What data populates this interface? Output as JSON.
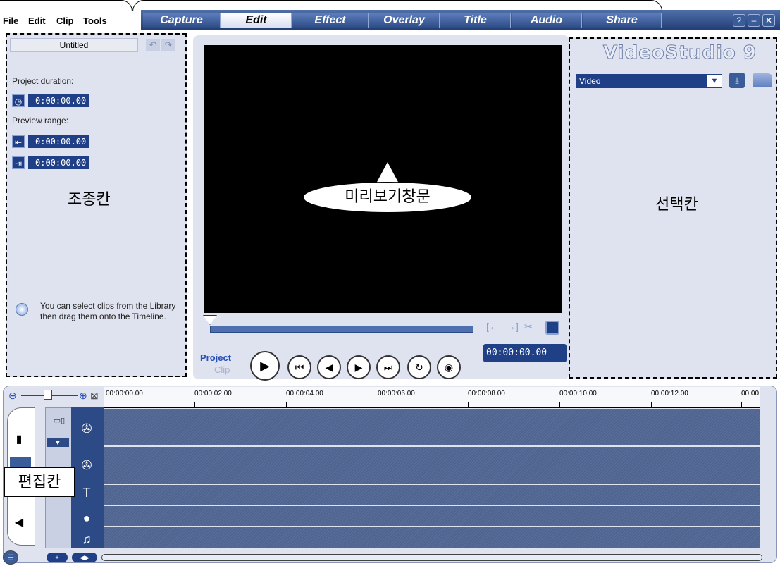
{
  "menu": [
    "File",
    "Edit",
    "Clip",
    "Tools"
  ],
  "tabs": [
    "Capture",
    "Edit",
    "Effect",
    "Overlay",
    "Title",
    "Audio",
    "Share"
  ],
  "active_tab": "Edit",
  "window_buttons": [
    "?",
    "–",
    "✕"
  ],
  "left_panel": {
    "project_name": "Untitled",
    "project_duration_label": "Project duration:",
    "project_duration": "0:00:00.00",
    "preview_range_label": "Preview range:",
    "range_start": "0:00:00.00",
    "range_end": "0:00:00.00",
    "region_label": "조종칸",
    "hint": "You can select clips from the Library then drag them onto the Timeline."
  },
  "preview": {
    "bubble_text": "미리보기창문",
    "mode_project": "Project",
    "mode_clip": "Clip",
    "timecode": "00:00:00.00"
  },
  "library": {
    "brand": "VideoStudio 9",
    "selected": "Video",
    "region_label": "선택칸"
  },
  "timeline": {
    "ticks": [
      "00:00:00.00",
      "00:00:02.00",
      "00:00:04.00",
      "00:00:06.00",
      "00:00:08.00",
      "00:00:10.00",
      "00:00:12.00",
      "00:00"
    ],
    "region_label": "편집칸"
  },
  "colors": {
    "accent": "#1f3f86",
    "panel": "#dfe3f0",
    "tab_bar": "#2c4a86"
  }
}
